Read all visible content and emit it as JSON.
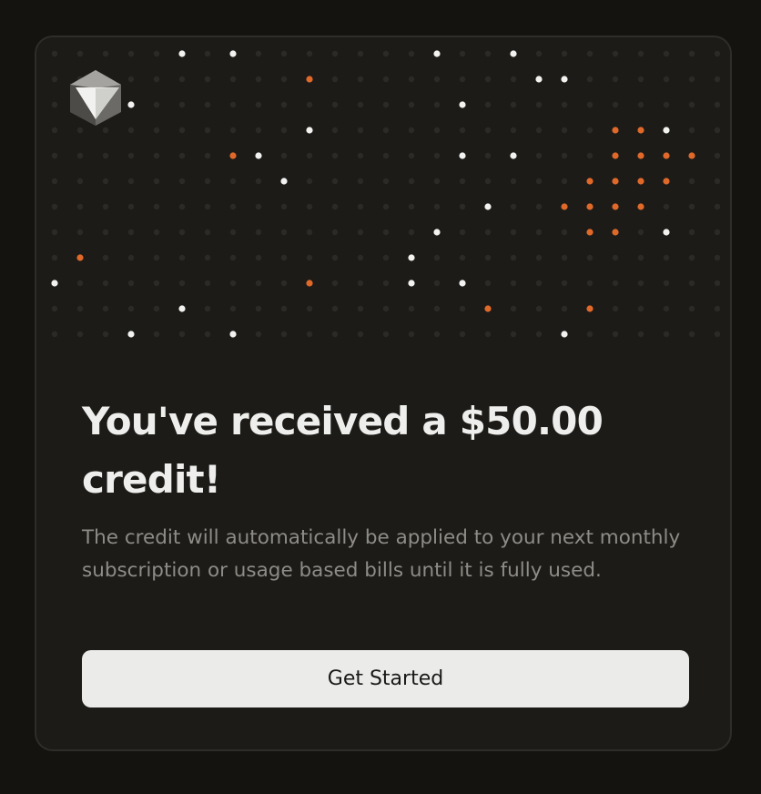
{
  "modal": {
    "title": "You've received a $50.00 credit!",
    "description": "The credit will automatically be applied to your next monthly subscription or usage based bills until it is fully used.",
    "button_label": "Get Started"
  },
  "colors": {
    "page_background": "#14130f",
    "card_background": "#1c1b18",
    "dot_idle": "#2b2a27",
    "dot_white": "#f2f2f0",
    "dot_orange": "#e0692a",
    "button_background": "#ebebea"
  },
  "icons": {
    "logo": "cube-logo-icon"
  }
}
